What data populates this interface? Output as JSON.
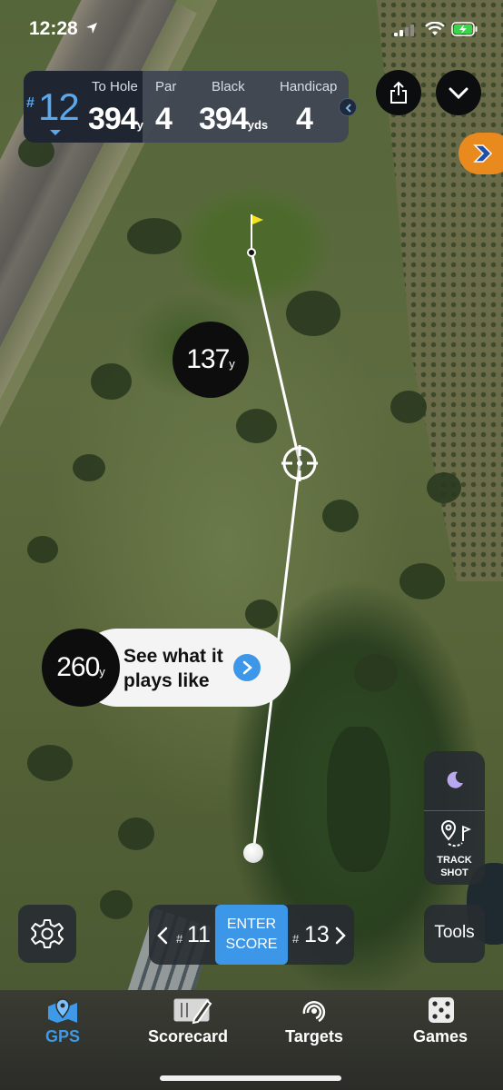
{
  "status_bar": {
    "time": "12:28",
    "icons": [
      "location-arrow-icon",
      "cellular-signal-icon",
      "wifi-icon",
      "battery-charging-icon"
    ]
  },
  "hole_panel": {
    "hash": "#",
    "hole_number": "12",
    "to_hole_label": "To Hole",
    "to_hole_value": "394",
    "to_hole_unit": "y",
    "par_label": "Par",
    "par_value": "4",
    "tee_label": "Black",
    "tee_value": "394",
    "tee_unit": "yds",
    "handicap_label": "Handicap",
    "handicap_value": "4"
  },
  "map": {
    "pin_distance": "137",
    "pin_distance_unit": "y",
    "layup_distance": "260",
    "layup_distance_unit": "y",
    "plays_like_line1": "See what it",
    "plays_like_line2": "plays like"
  },
  "side_tools": {
    "track_shot_line1": "TRACK",
    "track_shot_line2": "SHOT",
    "tools_label": "Tools"
  },
  "hole_nav": {
    "prev_hash": "#",
    "prev_hole": "11",
    "enter_line1": "ENTER",
    "enter_line2": "SCORE",
    "next_hash": "#",
    "next_hole": "13"
  },
  "tabs": [
    {
      "label": "GPS",
      "icon": "map-pin-icon",
      "active": true
    },
    {
      "label": "Scorecard",
      "icon": "scorecard-icon",
      "active": false
    },
    {
      "label": "Targets",
      "icon": "target-icon",
      "active": false
    },
    {
      "label": "Games",
      "icon": "dice-icon",
      "active": false
    }
  ],
  "colors": {
    "accent_blue": "#3c97e8",
    "hole_number_blue": "#5aa8ee",
    "promo_orange": "#e88a1e",
    "flag_yellow": "#f2e21c"
  }
}
